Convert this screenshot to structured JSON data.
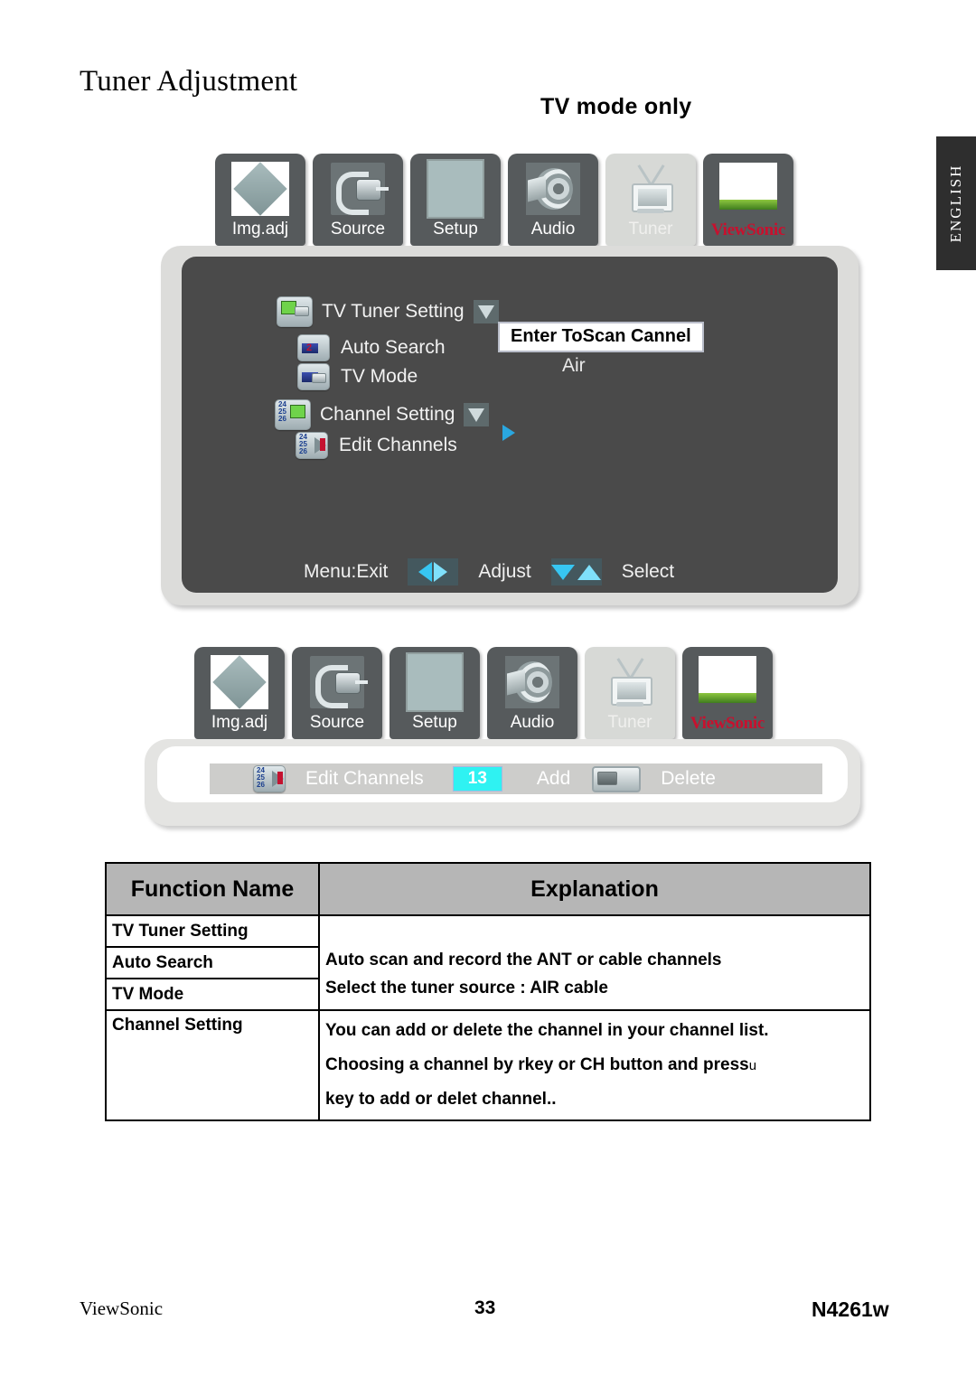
{
  "page": {
    "title": "Tuner Adjustment",
    "subtitle": "TV mode only",
    "language_tab": "ENGLISH"
  },
  "tabbar": {
    "items": [
      {
        "label": "Img.adj",
        "icon": "image-adjust-icon",
        "selected": false
      },
      {
        "label": "Source",
        "icon": "source-plug-icon",
        "selected": false
      },
      {
        "label": "Setup",
        "icon": "setup-screen-icon",
        "selected": false
      },
      {
        "label": "Audio",
        "icon": "speaker-icon",
        "selected": false
      },
      {
        "label": "Tuner",
        "icon": "tv-antenna-icon",
        "selected": true
      },
      {
        "label": "ViewSonic",
        "icon": "viewsonic-birds-logo-icon",
        "selected": false
      }
    ]
  },
  "osd_menu": {
    "rows": [
      {
        "label": "TV  Tuner Setting",
        "icon": "tv-tuner-setting-icon",
        "marker": "triangle-down"
      },
      {
        "label": "Auto Search",
        "icon": "auto-search-icon",
        "marker": ""
      },
      {
        "label": "TV Mode",
        "icon": "tv-mode-icon",
        "marker": ""
      },
      {
        "label": "Channel Setting",
        "icon": "channel-setting-icon",
        "marker": "triangle-down"
      },
      {
        "label": "Edit Channels",
        "icon": "edit-channels-icon",
        "marker": "arrow-right"
      }
    ],
    "auto_search_value": "Enter ToScan Cannel",
    "tv_mode_value": "Air",
    "hints": {
      "exit": "Menu:Exit",
      "adjust": "Adjust",
      "select": "Select"
    }
  },
  "osd_channel_bar": {
    "icon": "edit-channels-icon",
    "label": "Edit Channels",
    "channel": "13",
    "add_label": "Add",
    "delete_label": "Delete"
  },
  "table": {
    "headers": [
      "Function Name",
      "Explanation"
    ],
    "rows": [
      {
        "name": "TV Tuner Setting",
        "explanation": ""
      },
      {
        "name": "Auto Search",
        "explanation": "Auto scan and record the ANT or cable channels"
      },
      {
        "name": "TV Mode",
        "explanation": "Select the tuner source : AIR    cable"
      },
      {
        "name": "Channel Setting",
        "lines": [
          "You can add or delete the channel in your channel list.",
          "Choosing a channel by  rkey or CH button and press",
          "key to add or delet channel.."
        ],
        "trailing_sup": "u"
      }
    ]
  },
  "footer": {
    "brand": "ViewSonic",
    "page_number": "33",
    "model": "N4261w"
  },
  "colors": {
    "osd_panel": "#4a4a4a",
    "osd_frame": "#dcdcda",
    "tab": "#565a5c",
    "tab_selected": "#d7d9d6",
    "highlight_cyan": "#2ff2f2",
    "accent_blue": "#2aa7e0",
    "brand_red": "#c8102e",
    "table_header": "#b6b6b6"
  }
}
